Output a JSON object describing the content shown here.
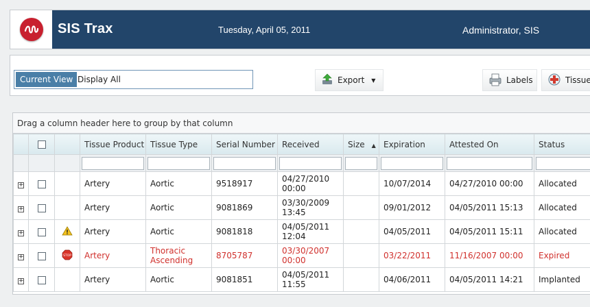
{
  "header": {
    "app_title": "SIS Trax",
    "date": "Tuesday, April 05, 2011",
    "user": "Administrator, SIS",
    "logo_icon": "sis-logo",
    "brand_color": "#22456a",
    "logo_color": "#c8202f"
  },
  "toolbar": {
    "current_view_label": "Current View",
    "view_value": "Display All",
    "export_label": "Export",
    "labels_label": "Labels",
    "tissue_label": "Tissue"
  },
  "grid": {
    "group_hint": "Drag a column header here to group by that column",
    "columns": [
      "Tissue Product",
      "Tissue Type",
      "Serial Number",
      "Received",
      "Size",
      "Expiration",
      "Attested On",
      "Status"
    ],
    "sorted_column": "Size",
    "rows": [
      {
        "icon": "",
        "product": "Artery",
        "type": "Aortic",
        "serial": "9518917",
        "received": "04/27/2010 00:00",
        "size": "",
        "expiration": "10/07/2014",
        "attested": "04/27/2010 00:00",
        "status": "Allocated"
      },
      {
        "icon": "",
        "product": "Artery",
        "type": "Aortic",
        "serial": "9081869",
        "received": "03/30/2009 13:45",
        "size": "",
        "expiration": "09/01/2012",
        "attested": "04/05/2011 15:13",
        "status": "Allocated"
      },
      {
        "icon": "warning-icon",
        "product": "Artery",
        "type": "Aortic",
        "serial": "9081818",
        "received": "04/05/2011 12:04",
        "size": "",
        "expiration": "04/05/2011",
        "attested": "04/05/2011 15:11",
        "status": "Allocated"
      },
      {
        "icon": "stop-icon",
        "product": "Artery",
        "type": "Thoracic Ascending",
        "serial": "8705787",
        "received": "03/30/2007 00:00",
        "size": "",
        "expiration": "03/22/2011",
        "attested": "11/16/2007 00:00",
        "status": "Expired"
      },
      {
        "icon": "",
        "product": "Artery",
        "type": "Aortic",
        "serial": "9081851",
        "received": "04/05/2011 11:55",
        "size": "",
        "expiration": "04/06/2011",
        "attested": "04/05/2011 14:21",
        "status": "Implanted"
      }
    ],
    "expired_color": "#d0302c"
  }
}
